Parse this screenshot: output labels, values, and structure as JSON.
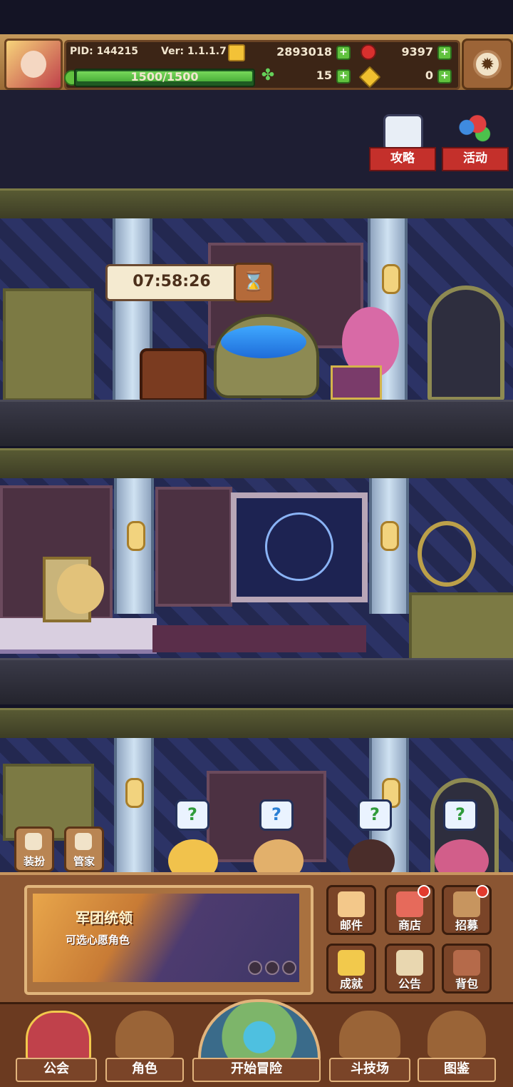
{
  "header": {
    "pid": "PID: 144215",
    "version": "Ver: 1.1.1.7",
    "gold": "2893018",
    "ruby": "9397",
    "stamina": "1500/1500",
    "stamina_fraction": 1.0,
    "clover": "15",
    "keys": "0"
  },
  "top_buttons": {
    "guide": "攻略",
    "event": "活动"
  },
  "timer": {
    "value": "07:58:26"
  },
  "left_buttons": {
    "dress": "装扮",
    "butler": "管家"
  },
  "speech_bubbles": [
    "?",
    "?",
    "?",
    "?"
  ],
  "banner": {
    "title": "军团统领",
    "subtitle": "可选心愿角色"
  },
  "grid_buttons": [
    {
      "label": "邮件",
      "badge": false
    },
    {
      "label": "商店",
      "badge": true
    },
    {
      "label": "招募",
      "badge": true
    },
    {
      "label": "成就",
      "badge": false
    },
    {
      "label": "公告",
      "badge": false
    },
    {
      "label": "背包",
      "badge": false
    }
  ],
  "nav": {
    "guild": "公会",
    "character": "角色",
    "adventure": "开始冒险",
    "arena": "斗技场",
    "codex": "图鉴"
  },
  "colors": {
    "accent_red": "#c4302b",
    "gold": "#f3c237",
    "stamina_green": "#61c23f",
    "panel_brown": "#8a5532"
  }
}
